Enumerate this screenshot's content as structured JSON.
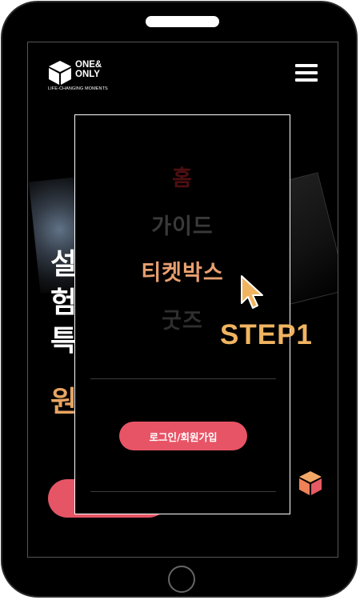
{
  "brand": {
    "name_line1": "ONE&",
    "name_line2": "ONLY",
    "tagline": "LIFE-CHANGING MOMENTS"
  },
  "hero_fragments": [
    "설",
    "험",
    "특",
    "원"
  ],
  "menu": {
    "items": [
      {
        "label": "홈",
        "state": "dim"
      },
      {
        "label": "가이드",
        "state": "dim"
      },
      {
        "label": "티켓박스",
        "state": "highlighted"
      },
      {
        "label": "굿즈",
        "state": "dim"
      }
    ],
    "login_button": "로그인/회원가입"
  },
  "annotation": {
    "step": "STEP1"
  },
  "colors": {
    "accent_pink": "#e75466",
    "accent_orange": "#e8a070",
    "step_yellow": "#f0b461",
    "background": "#000000"
  },
  "icons": [
    "brand-cube-icon",
    "hamburger-menu-icon",
    "pointer-cursor-icon",
    "corner-cube-icon"
  ]
}
